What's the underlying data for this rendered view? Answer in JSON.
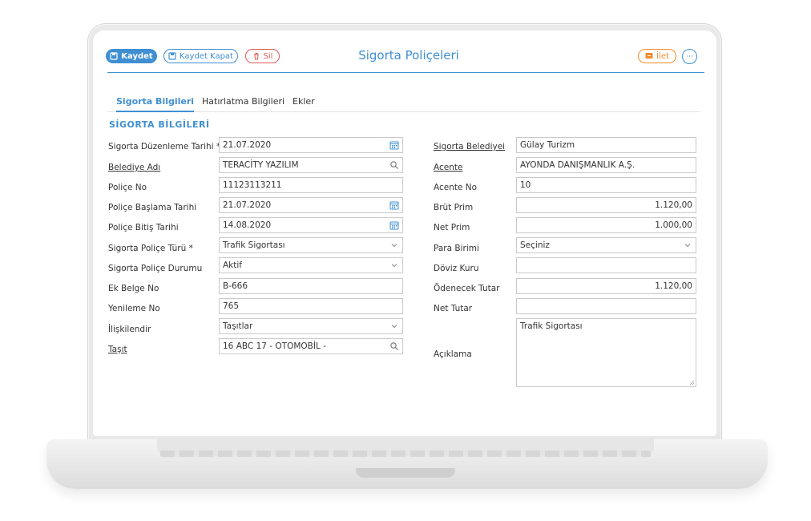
{
  "toolbar": {
    "save_label": "Kaydet",
    "save_close_label": "Kaydet Kapat",
    "delete_label": "Sil",
    "forward_label": "İlet",
    "more_label": "···"
  },
  "page": {
    "title": "Sigorta Poliçeleri"
  },
  "tabs": [
    {
      "label": "Sigorta Bilgileri",
      "active": true
    },
    {
      "label": "Hatırlatma Bilgileri"
    },
    {
      "label": "Ekler"
    }
  ],
  "section": {
    "title": "SİGORTA BİLGİLERİ"
  },
  "left": {
    "issue_date": {
      "label": "Sigorta Düzenleme Tarihi *",
      "value": "21.07.2020"
    },
    "municipality": {
      "label": "Belediye Adı",
      "value": "TERACİTY YAZILIM"
    },
    "policy_no": {
      "label": "Poliçe No",
      "value": "11123113211"
    },
    "start_date": {
      "label": "Poliçe Başlama Tarihi",
      "value": "21.07.2020"
    },
    "end_date": {
      "label": "Poliçe Bitiş Tarihi",
      "value": "14.08.2020"
    },
    "policy_type": {
      "label": "Sigorta Poliçe Türü *",
      "value": "Trafik Sigortası"
    },
    "policy_status": {
      "label": "Sigorta Poliçe Durumu",
      "value": "Aktif"
    },
    "extra_doc_no": {
      "label": "Ek Belge No",
      "value": "B-666"
    },
    "renewal_no": {
      "label": "Yenileme No",
      "value": "765"
    },
    "related": {
      "label": "İlişkilendir",
      "value": "Taşıtlar"
    },
    "vehicle": {
      "label": "Taşıt",
      "value": "16 ABC 17 - OTOMOBİL -"
    }
  },
  "right": {
    "insurance_company": {
      "label": "Sigorta Belediyei",
      "value": "Gülay Turizm"
    },
    "agency": {
      "label": "Acente",
      "value": "AYONDA DANIŞMANLIK A.Ş."
    },
    "agency_no": {
      "label": "Acente No",
      "value": "10"
    },
    "gross_premium": {
      "label": "Brüt Prim",
      "value": "1.120,00"
    },
    "net_premium": {
      "label": "Net Prim",
      "value": "1.000,00"
    },
    "currency": {
      "label": "Para Birimi",
      "value": "Seçiniz"
    },
    "exchange_rate": {
      "label": "Döviz Kuru",
      "value": ""
    },
    "amount_payable": {
      "label": "Ödenecek Tutar",
      "value": "1.120,00"
    },
    "net_amount": {
      "label": "Net Tutar",
      "value": ""
    },
    "description": {
      "label": "Açıklama",
      "value": "Trafik Sigortası"
    }
  },
  "colors": {
    "accent": "#3f8fd2",
    "danger": "#e05a5a",
    "warning": "#f28c28"
  },
  "icons": [
    "save-icon",
    "save-close-icon",
    "trash-icon",
    "forward-icon",
    "more-icon",
    "calendar-icon",
    "search-icon",
    "chevron-down-icon"
  ]
}
